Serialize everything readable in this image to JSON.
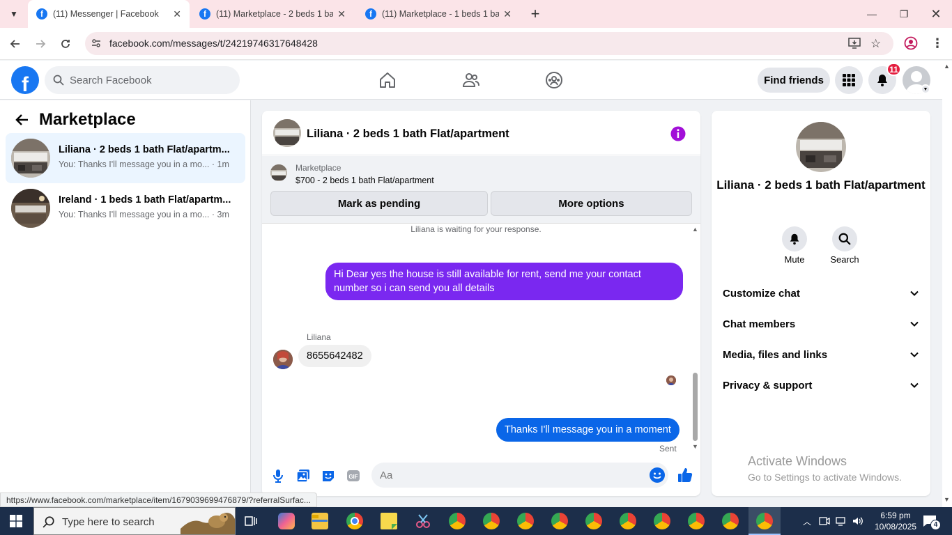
{
  "browser": {
    "tabs": [
      {
        "title": "(11) Messenger | Facebook",
        "active": true
      },
      {
        "title": "(11) Marketplace - 2 beds 1 bath",
        "active": false
      },
      {
        "title": "(11) Marketplace - 1 beds 1 bath",
        "active": false
      }
    ],
    "url": "facebook.com/messages/t/24219746317648428",
    "status_url": "https://www.facebook.com/marketplace/item/1679039699476879/?referralSurfac..."
  },
  "fb_header": {
    "search_placeholder": "Search Facebook",
    "find_friends": "Find friends",
    "notification_count": "11"
  },
  "left_panel": {
    "title": "Marketplace",
    "conversations": [
      {
        "name": "Liliana · 2 beds 1 bath Flat/apartm...",
        "snippet": "You: Thanks I'll message you in a mo... · 1m"
      },
      {
        "name": "Ireland · 1 beds 1 bath Flat/apartm...",
        "snippet": "You: Thanks I'll message you in a mo... · 3m"
      }
    ]
  },
  "chat": {
    "title": "Liliana · 2 beds 1 bath Flat/apartment",
    "marketplace_label": "Marketplace",
    "listing": "$700 - 2 beds 1 bath Flat/apartment",
    "mark_pending": "Mark as pending",
    "more_options": "More options",
    "waiting_text": "Liliana is waiting for your response.",
    "messages": {
      "out1": "Hi Dear yes the house is still available for rent, send me your contact number so i can send you all details",
      "in_sender": "Liliana",
      "in1": "8655642482",
      "out2": "Thanks I'll message you in a moment",
      "status": "Sent"
    },
    "input_placeholder": "Aa"
  },
  "info_panel": {
    "name": "Liliana · 2 beds 1 bath Flat/apartment",
    "mute": "Mute",
    "search": "Search",
    "sections": [
      "Customize chat",
      "Chat members",
      "Media, files and links",
      "Privacy & support"
    ]
  },
  "watermark": {
    "line1": "Activate Windows",
    "line2": "Go to Settings to activate Windows."
  },
  "taskbar": {
    "search_placeholder": "Type here to search",
    "time": "6:59 pm",
    "date": "10/08/2025",
    "notif_count": "4"
  },
  "colors": {
    "fb_blue": "#1877f2",
    "bubble_purple": "#7a28f0",
    "bubble_blue": "#0a66e8",
    "badge_red": "#e41e3f"
  }
}
